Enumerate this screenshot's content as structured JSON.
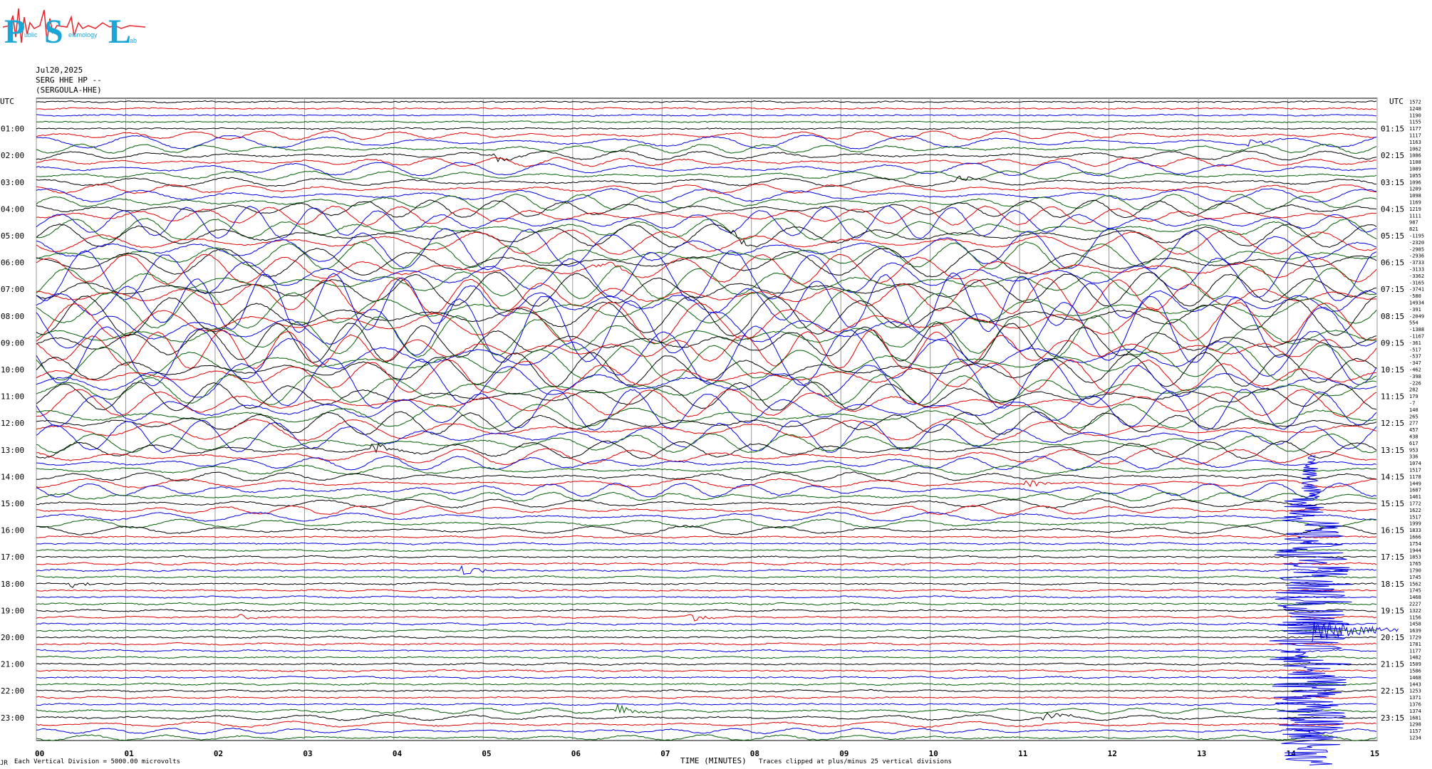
{
  "logo": {
    "big_p": "P",
    "big_s": "S",
    "big_l": "L",
    "small_p": "ublic",
    "small_s": "eismology",
    "small_l": "ab",
    "accent_color": "#1aa6d6",
    "wave_color": "#e8232a"
  },
  "header": {
    "date": "Jul20,2025",
    "channel": "SERG HHE HP --",
    "station": "(SERGOULA-HHE)"
  },
  "chart_data": {
    "type": "line",
    "left_axis_label": "UTC",
    "right_axis_label": "UTC",
    "left_hour_labels": [
      "01:00",
      "02:00",
      "03:00",
      "04:00",
      "05:00",
      "06:00",
      "07:00",
      "08:00",
      "09:00",
      "10:00",
      "11:00",
      "12:00",
      "13:00",
      "14:00",
      "15:00",
      "16:00",
      "17:00",
      "18:00",
      "19:00",
      "20:00",
      "21:00",
      "22:00",
      "23:00"
    ],
    "right_hour_labels": [
      "01:15",
      "02:15",
      "03:15",
      "04:15",
      "05:15",
      "06:15",
      "07:15",
      "08:15",
      "09:15",
      "10:15",
      "11:15",
      "12:15",
      "13:15",
      "14:15",
      "15:15",
      "16:15",
      "17:15",
      "18:15",
      "19:15",
      "20:15",
      "21:15",
      "22:15",
      "23:15"
    ],
    "x_tick_labels": [
      "00",
      "01",
      "02",
      "03",
      "04",
      "05",
      "06",
      "07",
      "08",
      "09",
      "10",
      "11",
      "12",
      "13",
      "14",
      "15"
    ],
    "xlim": [
      0,
      15
    ],
    "xlabel": "TIME (MINUTES)",
    "trace_count": 96,
    "trace_colors": [
      "#000000",
      "#e00000",
      "#0000e0",
      "#006000"
    ],
    "trace_offsets": [
      "1572",
      "1248",
      "1190",
      "1155",
      "1177",
      "1117",
      "1163",
      "1062",
      "1086",
      "1108",
      "1089",
      "1055",
      "1096",
      "1209",
      "1098",
      "1169",
      "1219",
      "1111",
      "987",
      "821",
      "-1195",
      "-2320",
      "-2985",
      "-2936",
      "-3733",
      "-3133",
      "-3362",
      "-3165",
      "-3741",
      "-580",
      "14934",
      "-391",
      "-2049",
      "554",
      "-1388",
      "-1167",
      "-361",
      "-517",
      "-537",
      "-347",
      "-462",
      "-398",
      "-226",
      "282",
      "179",
      "-7",
      "140",
      "265",
      "277",
      "457",
      "438",
      "617",
      "953",
      "336",
      "1074",
      "1517",
      "1178",
      "1449",
      "1687",
      "1461",
      "1772",
      "1622",
      "1517",
      "1999",
      "1833",
      "1666",
      "1754",
      "1944",
      "1853",
      "1765",
      "1790",
      "1745",
      "1562",
      "1745",
      "1468",
      "2227",
      "1322",
      "1156",
      "1458",
      "1639",
      "1729",
      "1781",
      "1177",
      "1482",
      "1509",
      "1586",
      "1468",
      "1443",
      "1253",
      "1371",
      "1376",
      "1374",
      "1681",
      "1298",
      "1157",
      "1234"
    ],
    "events": [
      {
        "trace": 6,
        "minute": 13.6
      },
      {
        "trace": 8,
        "minute": 5.1
      },
      {
        "trace": 12,
        "minute": 10.3
      },
      {
        "trace": 20,
        "minute": 7.8
      },
      {
        "trace": 25,
        "minute": 6.3
      },
      {
        "trace": 52,
        "minute": 3.8
      },
      {
        "trace": 57,
        "minute": 11.1
      },
      {
        "trace": 70,
        "minute": 4.8
      },
      {
        "trace": 72,
        "minute": 0.4
      },
      {
        "trace": 77,
        "minute": 2.3
      },
      {
        "trace": 77,
        "minute": 7.3
      },
      {
        "trace": 92,
        "minute": 11.3
      },
      {
        "trace": 91,
        "minute": 6.5
      }
    ],
    "big_event_minute": 14.15,
    "clip_divisions": 25
  },
  "footer": {
    "scale_text": "Each Vertical Division = 5000.00 microvolts",
    "clip_text": "Traces clipped at plus/minus 25 vertical divisions",
    "corner_mark": "JR"
  }
}
